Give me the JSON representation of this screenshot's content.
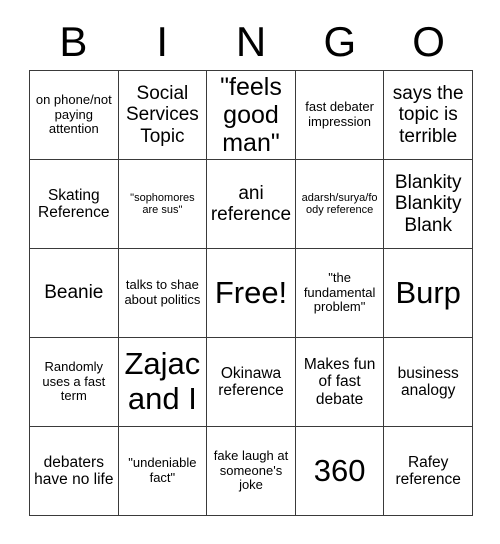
{
  "card": {
    "title": "BINGO",
    "header_letters": [
      "B",
      "I",
      "N",
      "G",
      "O"
    ],
    "columns": 5,
    "rows": 5,
    "border_color": "#3a3a3a",
    "background_color": "#ffffff",
    "text_color": "#000000",
    "free_space": {
      "row": 3,
      "column": 3,
      "label": "Free!"
    },
    "cells": [
      {
        "id": "b1",
        "column": "B",
        "row": 1,
        "text": "on phone/not paying attention",
        "size": "s"
      },
      {
        "id": "i1",
        "column": "I",
        "row": 1,
        "text": "Social Services Topic",
        "size": "l"
      },
      {
        "id": "n1",
        "column": "N",
        "row": 1,
        "text": "\"feels good man\"",
        "size": "xl"
      },
      {
        "id": "g1",
        "column": "G",
        "row": 1,
        "text": "fast debater impression",
        "size": "s"
      },
      {
        "id": "o1",
        "column": "O",
        "row": 1,
        "text": "says the topic is terrible",
        "size": "l"
      },
      {
        "id": "b2",
        "column": "B",
        "row": 2,
        "text": "Skating Reference",
        "size": "m"
      },
      {
        "id": "i2",
        "column": "I",
        "row": 2,
        "text": "\"sophomores are sus\"",
        "size": "xs"
      },
      {
        "id": "n2",
        "column": "N",
        "row": 2,
        "text": "ani reference",
        "size": "l"
      },
      {
        "id": "g2",
        "column": "G",
        "row": 2,
        "text": "adarsh/surya/foody reference",
        "size": "xs"
      },
      {
        "id": "o2",
        "column": "O",
        "row": 2,
        "text": "Blankity Blankity Blank",
        "size": "l"
      },
      {
        "id": "b3",
        "column": "B",
        "row": 3,
        "text": "Beanie",
        "size": "l"
      },
      {
        "id": "i3",
        "column": "I",
        "row": 3,
        "text": "talks to shae about politics",
        "size": "s"
      },
      {
        "id": "n3",
        "column": "N",
        "row": 3,
        "text": "Free!",
        "size": "xxl"
      },
      {
        "id": "g3",
        "column": "G",
        "row": 3,
        "text": "\"the fundamental problem\"",
        "size": "s"
      },
      {
        "id": "o3",
        "column": "O",
        "row": 3,
        "text": "Burp",
        "size": "xxl"
      },
      {
        "id": "b4",
        "column": "B",
        "row": 4,
        "text": "Randomly uses a fast term",
        "size": "s"
      },
      {
        "id": "i4",
        "column": "I",
        "row": 4,
        "text": "Zajac and I",
        "size": "xxl"
      },
      {
        "id": "n4",
        "column": "N",
        "row": 4,
        "text": "Okinawa reference",
        "size": "m"
      },
      {
        "id": "g4",
        "column": "G",
        "row": 4,
        "text": "Makes fun of fast debate",
        "size": "m"
      },
      {
        "id": "o4",
        "column": "O",
        "row": 4,
        "text": "business analogy",
        "size": "m"
      },
      {
        "id": "b5",
        "column": "B",
        "row": 5,
        "text": "debaters have no life",
        "size": "m"
      },
      {
        "id": "i5",
        "column": "I",
        "row": 5,
        "text": "\"undeniable fact\"",
        "size": "s"
      },
      {
        "id": "n5",
        "column": "N",
        "row": 5,
        "text": "fake laugh at someone's joke",
        "size": "s"
      },
      {
        "id": "g5",
        "column": "G",
        "row": 5,
        "text": "360",
        "size": "xxl"
      },
      {
        "id": "o5",
        "column": "O",
        "row": 5,
        "text": "Rafey reference",
        "size": "m"
      }
    ]
  }
}
